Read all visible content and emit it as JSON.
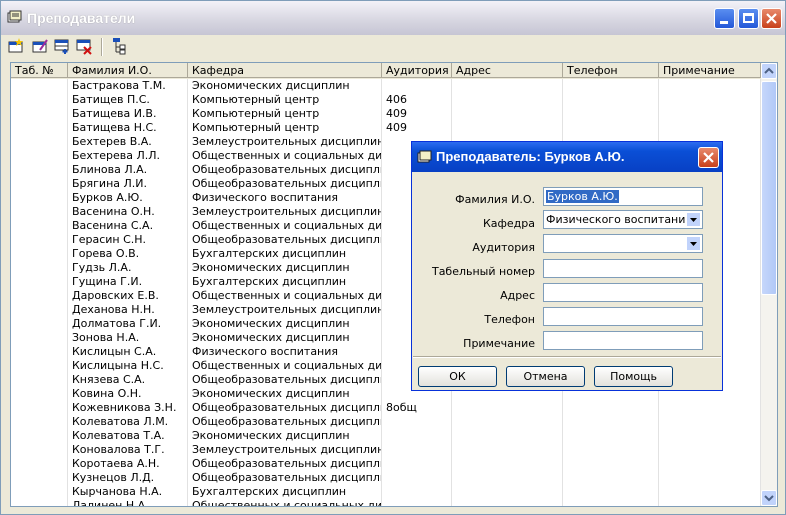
{
  "window": {
    "title": "Преподаватели",
    "toolbar": [
      "new-record-icon",
      "edit-record-icon",
      "add-row-icon",
      "delete-row-icon",
      "tree-filter-icon"
    ]
  },
  "grid": {
    "columns": [
      "Таб. №",
      "Фамилия И.О.",
      "Кафедра",
      "Аудитория",
      "Адрес",
      "Телефон",
      "Примечание"
    ],
    "rows": [
      {
        "name": "Бастракова Т.М.",
        "dept": "Экономических дисциплин",
        "room": ""
      },
      {
        "name": "Батищев П.С.",
        "dept": "Компьютерный центр",
        "room": "406"
      },
      {
        "name": "Батищева И.В.",
        "dept": "Компьютерный центр",
        "room": "409"
      },
      {
        "name": "Батищева Н.С.",
        "dept": "Компьютерный центр",
        "room": "409"
      },
      {
        "name": "Бехтерев В.А.",
        "dept": "Землеустроительных дисциплин",
        "room": ""
      },
      {
        "name": "Бехтерева Л.Л.",
        "dept": "Общественных и социальных дис...",
        "room": ""
      },
      {
        "name": "Блинова Л.А.",
        "dept": "Общеобразовательных дисциплин",
        "room": ""
      },
      {
        "name": "Брягина Л.И.",
        "dept": "Общеобразовательных дисциплин",
        "room": ""
      },
      {
        "name": "Бурков А.Ю.",
        "dept": "Физического воспитания",
        "room": ""
      },
      {
        "name": "Васенина О.Н.",
        "dept": "Землеустроительных дисциплин",
        "room": ""
      },
      {
        "name": "Васенина С.А.",
        "dept": "Общественных и социальных дис...",
        "room": ""
      },
      {
        "name": "Герасин С.Н.",
        "dept": "Общеобразовательных дисциплин",
        "room": ""
      },
      {
        "name": "Горева О.В.",
        "dept": "Бухгалтерских дисциплин",
        "room": ""
      },
      {
        "name": "Гудзь Л.А.",
        "dept": "Экономических дисциплин",
        "room": ""
      },
      {
        "name": "Гущина Г.И.",
        "dept": "Бухгалтерских дисциплин",
        "room": ""
      },
      {
        "name": "Даровских Е.В.",
        "dept": "Общественных и социальных дис...",
        "room": ""
      },
      {
        "name": "Деханова Н.Н.",
        "dept": "Землеустроительных дисциплин",
        "room": ""
      },
      {
        "name": "Долматова Г.И.",
        "dept": "Экономических дисциплин",
        "room": ""
      },
      {
        "name": "Зонова Н.А.",
        "dept": "Экономических дисциплин",
        "room": ""
      },
      {
        "name": "Кислицын С.А.",
        "dept": "Физического воспитания",
        "room": ""
      },
      {
        "name": "Кислицына Н.С.",
        "dept": "Общественных и социальных дис...",
        "room": ""
      },
      {
        "name": "Князева С.А.",
        "dept": "Общеобразовательных дисциплин",
        "room": ""
      },
      {
        "name": "Ковина О.Н.",
        "dept": "Экономических дисциплин",
        "room": ""
      },
      {
        "name": "Кожевникова З.Н.",
        "dept": "Общеобразовательных дисциплин",
        "room": "8общ"
      },
      {
        "name": "Колеватова Л.М.",
        "dept": "Общеобразовательных дисциплин",
        "room": ""
      },
      {
        "name": "Колеватова Т.А.",
        "dept": "Экономических дисциплин",
        "room": ""
      },
      {
        "name": "Коновалова Т.Г.",
        "dept": "Землеустроительных дисциплин",
        "room": ""
      },
      {
        "name": "Коротаева А.Н.",
        "dept": "Общеобразовательных дисциплин",
        "room": ""
      },
      {
        "name": "Кузнецов Л.Д.",
        "dept": "Общеобразовательных дисциплин",
        "room": ""
      },
      {
        "name": "Кырчанова Н.А.",
        "dept": "Бухгалтерских дисциплин",
        "room": ""
      },
      {
        "name": "Лалинен Н.А.",
        "dept": "Общественных и социальных дис...",
        "room": ""
      }
    ]
  },
  "dialog": {
    "title": "Преподаватель: Бурков А.Ю.",
    "fields": [
      {
        "label": "Фамилия И.О.",
        "value": "Бурков А.Ю.",
        "type": "text",
        "selected": true
      },
      {
        "label": "Кафедра",
        "value": "Физического воспитания",
        "type": "combo"
      },
      {
        "label": "Аудитория",
        "value": "",
        "type": "combo"
      },
      {
        "label": "Табельный номер",
        "value": "",
        "type": "text"
      },
      {
        "label": "Адрес",
        "value": "",
        "type": "text"
      },
      {
        "label": "Телефон",
        "value": "",
        "type": "text"
      },
      {
        "label": "Примечание",
        "value": "",
        "type": "text"
      }
    ],
    "buttons": {
      "ok": "ОК",
      "cancel": "Отмена",
      "help": "Помощь"
    }
  },
  "colors": {
    "accent": "#0a4fd6",
    "selection": "#316ac5",
    "face": "#ece9d8"
  }
}
